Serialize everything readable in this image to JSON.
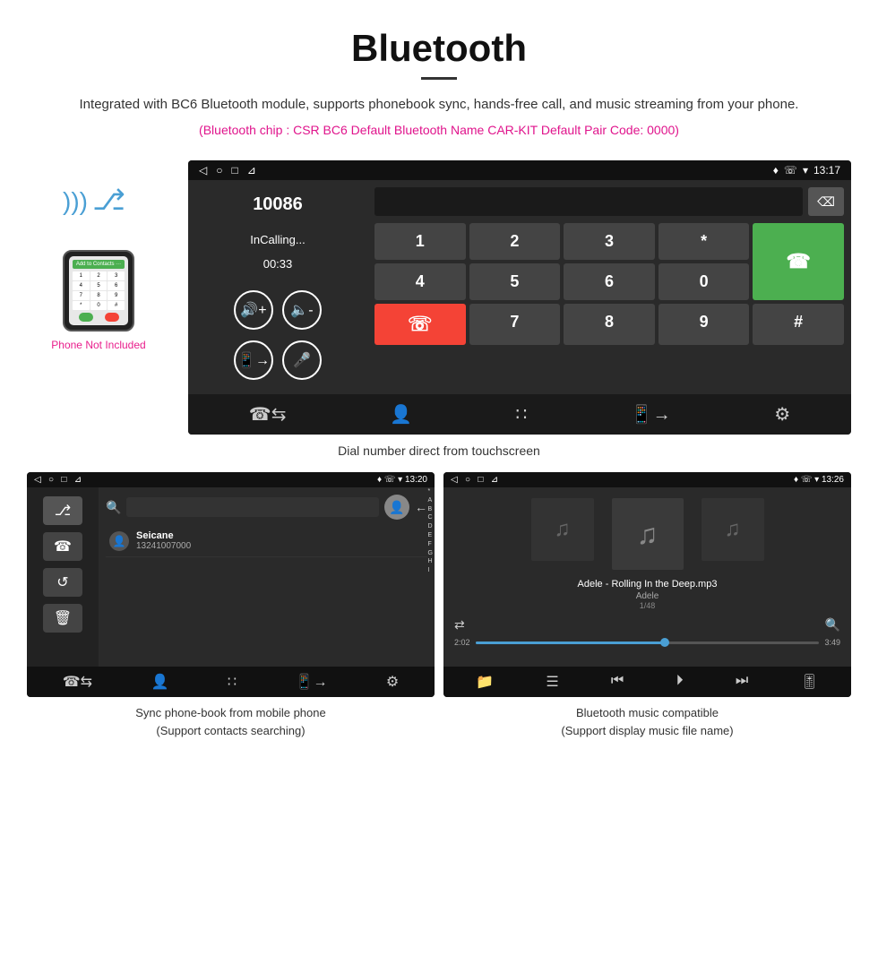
{
  "header": {
    "title": "Bluetooth",
    "description": "Integrated with BC6 Bluetooth module, supports phonebook sync, hands-free call, and music streaming from your phone.",
    "specs": "(Bluetooth chip : CSR BC6    Default Bluetooth Name CAR-KIT    Default Pair Code: 0000)"
  },
  "phone_label": "Phone Not Included",
  "main_screen": {
    "status_bar": {
      "nav_icons": "◁  ○  □  ⊿",
      "right_icons": "♦ ☏ ▾",
      "time": "13:17"
    },
    "dial_number": "10086",
    "in_calling": "InCalling...",
    "timer": "00:33",
    "dialpad_keys": [
      "1",
      "2",
      "3",
      "*",
      "4",
      "5",
      "6",
      "0",
      "7",
      "8",
      "9",
      "#"
    ],
    "green_icon": "☏",
    "red_icon": "☏"
  },
  "main_caption": "Dial number direct from touchscreen",
  "phonebook_screen": {
    "status_bar": {
      "left": "◁  ○  □  ⊿",
      "right": "♦ ☏ ▾  13:20"
    },
    "contact_name": "Seicane",
    "contact_number": "13241007000",
    "alphabet": [
      "*",
      "A",
      "B",
      "C",
      "D",
      "E",
      "F",
      "G",
      "H",
      "I"
    ]
  },
  "phonebook_caption_line1": "Sync phone-book from mobile phone",
  "phonebook_caption_line2": "(Support contacts searching)",
  "music_screen": {
    "status_bar": {
      "left": "◁  ○  □  ⊿",
      "right": "♦ ☏ ▾  13:26"
    },
    "song_title": "Adele - Rolling In the Deep.mp3",
    "artist": "Adele",
    "track_info": "1/48",
    "time_current": "2:02",
    "time_total": "3:49"
  },
  "music_caption_line1": "Bluetooth music compatible",
  "music_caption_line2": "(Support display music file name)"
}
